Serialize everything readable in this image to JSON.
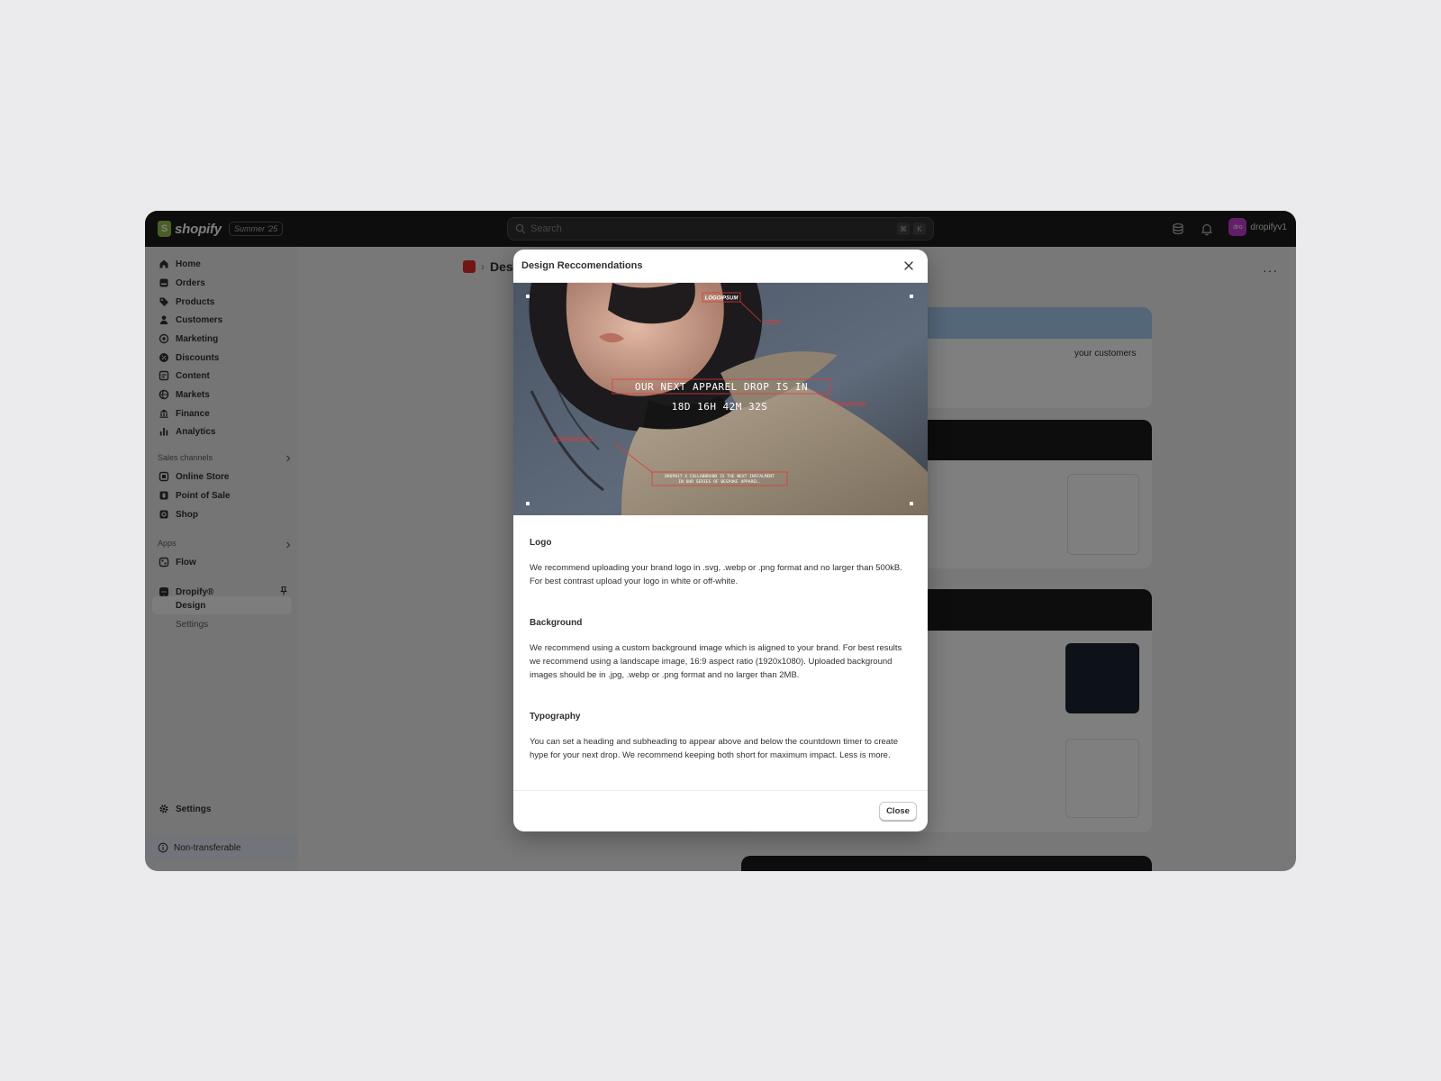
{
  "topbar": {
    "brand_name": "shopify",
    "brand_badge": "Summer '25",
    "search_placeholder": "Search",
    "shortcut_keys": [
      "⌘",
      "K"
    ],
    "account_initials": "dro",
    "account_name": "dropifyv1"
  },
  "sidebar": {
    "items": [
      {
        "label": "Home",
        "icon": "home-icon"
      },
      {
        "label": "Orders",
        "icon": "orders-icon"
      },
      {
        "label": "Products",
        "icon": "tag-icon"
      },
      {
        "label": "Customers",
        "icon": "person-icon"
      },
      {
        "label": "Marketing",
        "icon": "target-icon"
      },
      {
        "label": "Discounts",
        "icon": "discount-icon"
      },
      {
        "label": "Content",
        "icon": "content-icon"
      },
      {
        "label": "Markets",
        "icon": "globe-icon"
      },
      {
        "label": "Finance",
        "icon": "bank-icon"
      },
      {
        "label": "Analytics",
        "icon": "bar-chart-icon"
      }
    ],
    "sales_channels_label": "Sales channels",
    "sales_channels": [
      {
        "label": "Online Store",
        "icon": "store-icon"
      },
      {
        "label": "Point of Sale",
        "icon": "pos-icon"
      },
      {
        "label": "Shop",
        "icon": "shop-icon"
      }
    ],
    "apps_label": "Apps",
    "apps": [
      {
        "label": "Flow",
        "icon": "flow-icon"
      }
    ],
    "pinned_app": "Dropify®",
    "pinned_sub": [
      "Design",
      "Settings"
    ],
    "settings_label": "Settings",
    "notice": "Non-transferable"
  },
  "main": {
    "page_title": "Design",
    "more_label": "···",
    "card_text": "your customers"
  },
  "modal": {
    "title": "Design Reccomendations",
    "hero": {
      "logo_text": "LOGOIPSUM",
      "heading_line1": "OUR NEXT APPAREL DROP IS IN",
      "countdown": "18D 16H 42M 32S",
      "subheading_line1": "DROP017 X COLLABBRAND IS THE NEXT INSTALMENT",
      "subheading_line2": "IN OUR SERIES OF BESPOKE APPAREL.",
      "label_logo": "LOGO",
      "label_heading": "HEADING",
      "label_subheading": "SUBHEADING",
      "accent_color": "#e03a3a"
    },
    "sections": [
      {
        "title": "Logo",
        "text": "We recommend uploading your brand logo in .svg, .webp or .png format and no larger than 500kB. For best contrast upload your logo in white or off-white."
      },
      {
        "title": "Background",
        "text": "We recommend using a custom background image which is aligned to your brand. For best results we recommend using a landscape image, 16:9 aspect ratio (1920x1080). Uploaded background images should be in .jpg, .webp or .png format and no larger than 2MB."
      },
      {
        "title": "Typography",
        "text": "You can set a heading and subheading to appear above and below the countdown timer to create hype for your next drop. We recommend keeping both short for maximum impact. Less is more."
      }
    ],
    "close_label": "Close"
  }
}
